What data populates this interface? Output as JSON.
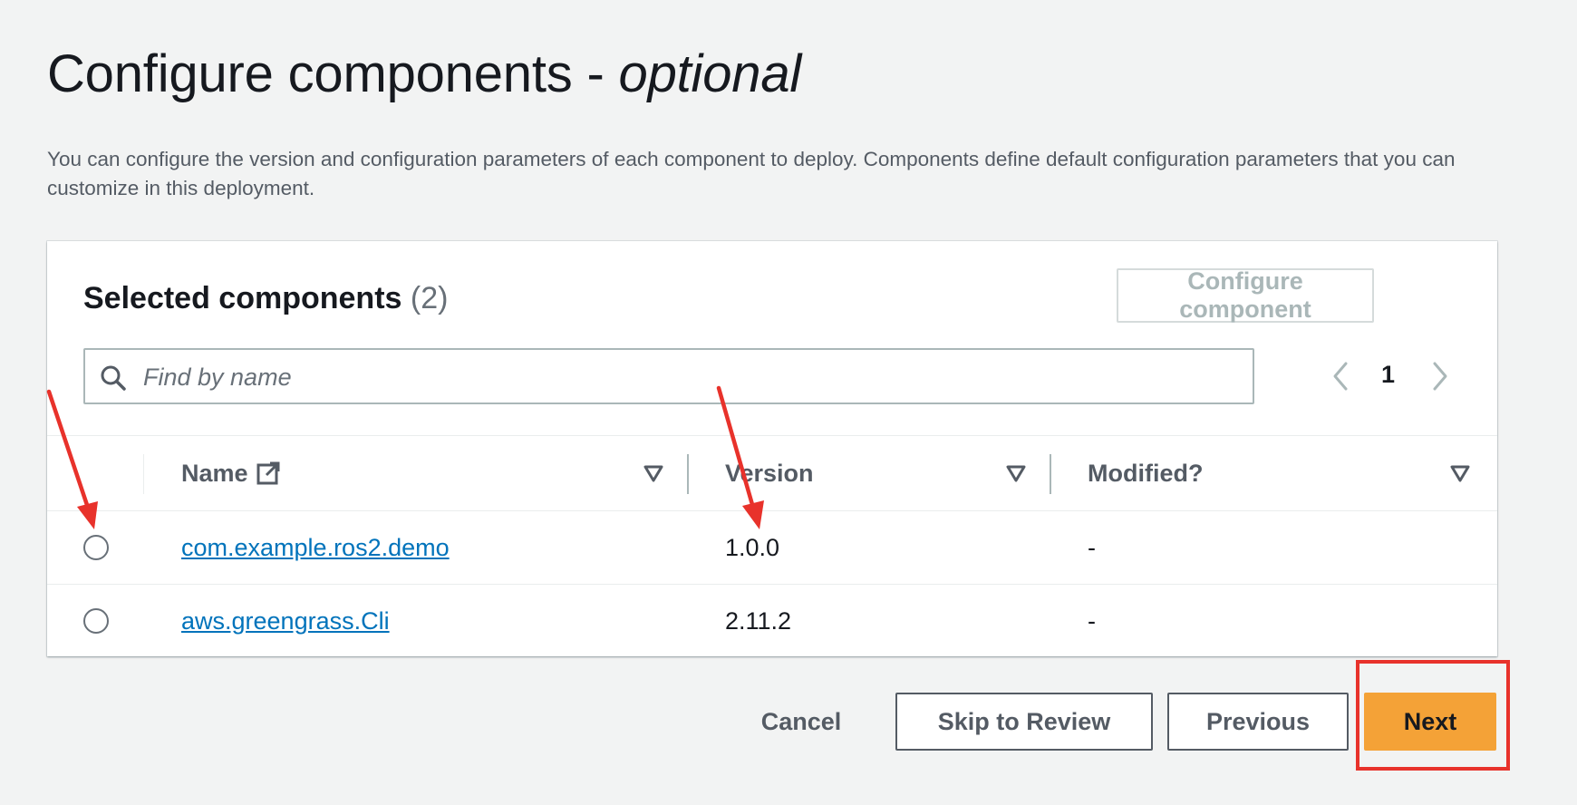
{
  "page": {
    "title": "Configure components - ",
    "title_optional": "optional",
    "description": "You can configure the version and configuration parameters of each component to deploy. Components define default configuration parameters that you can customize in this deployment."
  },
  "panel": {
    "heading": "Selected components",
    "count": "(2)",
    "configure_button": "Configure component",
    "search": {
      "placeholder": "Find by name",
      "value": ""
    },
    "pager": {
      "current_page": "1"
    }
  },
  "table": {
    "columns": [
      {
        "label": "Name"
      },
      {
        "label": "Version"
      },
      {
        "label": "Modified?"
      }
    ],
    "rows": [
      {
        "name": "com.example.ros2.demo",
        "version": "1.0.0",
        "modified": "-"
      },
      {
        "name": "aws.greengrass.Cli",
        "version": "2.11.2",
        "modified": "-"
      }
    ]
  },
  "actions": {
    "cancel": "Cancel",
    "skip": "Skip to Review",
    "previous": "Previous",
    "next": "Next"
  },
  "colors": {
    "primary_button": "#f4a237",
    "link": "#0073bb",
    "annotation": "#e8322b",
    "background": "#f2f3f3"
  }
}
